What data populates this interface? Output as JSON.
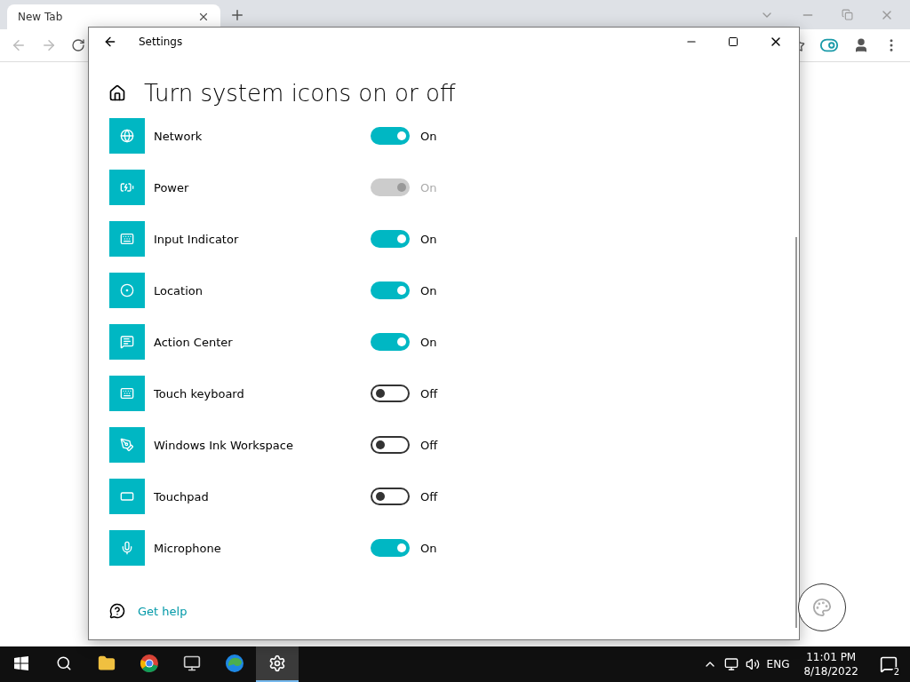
{
  "browser": {
    "tab": {
      "title": "New Tab",
      "selected": true
    }
  },
  "window": {
    "title": "Settings"
  },
  "page": {
    "heading": "Turn system icons on or off"
  },
  "items": [
    {
      "name": "Network",
      "on": true,
      "disabled": false,
      "status": "On"
    },
    {
      "name": "Power",
      "on": true,
      "disabled": true,
      "status": "On"
    },
    {
      "name": "Input Indicator",
      "on": true,
      "disabled": false,
      "status": "On"
    },
    {
      "name": "Location",
      "on": true,
      "disabled": false,
      "status": "On"
    },
    {
      "name": "Action Center",
      "on": true,
      "disabled": false,
      "status": "On"
    },
    {
      "name": "Touch keyboard",
      "on": false,
      "disabled": false,
      "status": "Off"
    },
    {
      "name": "Windows Ink Workspace",
      "on": false,
      "disabled": false,
      "status": "Off"
    },
    {
      "name": "Touchpad",
      "on": false,
      "disabled": false,
      "status": "Off"
    },
    {
      "name": "Microphone",
      "on": true,
      "disabled": false,
      "status": "On"
    }
  ],
  "help": {
    "label": "Get help"
  },
  "taskbar": {
    "apps": [
      {
        "kind": "folder",
        "selected": false
      },
      {
        "kind": "chrome",
        "selected": false
      },
      {
        "kind": "monitor",
        "selected": false
      },
      {
        "kind": "edge",
        "selected": false
      },
      {
        "kind": "settings",
        "selected": true
      }
    ],
    "language": "ENG",
    "time": "11:01 PM",
    "date": "8/18/2022",
    "notifications": "2"
  }
}
